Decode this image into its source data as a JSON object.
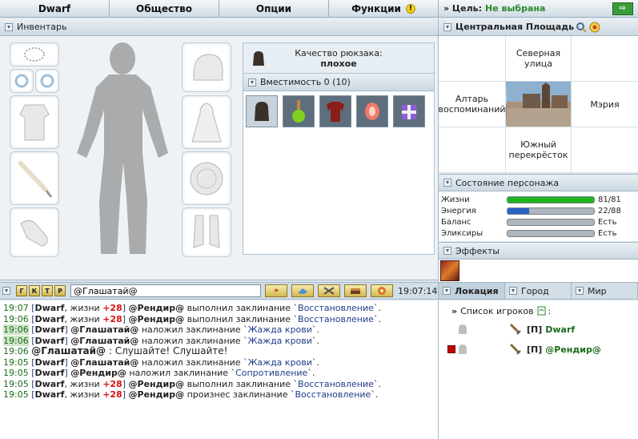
{
  "topbar": {
    "tabs": [
      "Dwarf",
      "Общество",
      "Опции",
      "Функции"
    ],
    "warn_glyph": "!"
  },
  "goal": {
    "label": "» Цель:",
    "value": "Не выбрана",
    "exit_glyph": "⇨"
  },
  "inventory": {
    "title": "Инвентарь",
    "bag_quality_label": "Качество рюкзака:",
    "bag_quality_value": "плохое",
    "capacity": "Вместимость 0 (10)"
  },
  "location": {
    "title": "Центральная Площадь",
    "north": "Северная улица",
    "west": "Алтарь воспоминаний",
    "east": "Мэрия",
    "south": "Южный перекрёсток"
  },
  "state": {
    "title": "Состояние персонажа",
    "rows": [
      {
        "label": "Жизни",
        "value": "81/81",
        "fraction": 1.0,
        "color": "#1fb51f"
      },
      {
        "label": "Энергия",
        "value": "22/88",
        "fraction": 0.25,
        "color": "#2b62c4"
      },
      {
        "label": "Баланс",
        "value": "Есть",
        "fraction": 0,
        "color": "#aeb6bd"
      },
      {
        "label": "Эликсиры",
        "value": "Есть",
        "fraction": 0,
        "color": "#aeb6bd"
      }
    ]
  },
  "effects": {
    "title": "Эффекты"
  },
  "chatbar": {
    "buttons": [
      "Г",
      "К",
      "Т",
      "Р"
    ],
    "input_value": "@Глашатай@",
    "send_glyph": "»",
    "clock": "19:07:14"
  },
  "right_tabs": [
    "Локация",
    "Город",
    "Мир"
  ],
  "players": {
    "title": "Список игроков",
    "colon": ":",
    "rows": [
      {
        "tag": "[П]",
        "name": "Dwarf"
      },
      {
        "tag": "[П]",
        "name": "@Рендир@"
      }
    ]
  },
  "chat": {
    "lines": [
      {
        "time": "19:07",
        "parts": [
          "[",
          "Dwarf",
          ", жизни ",
          "+28",
          "] ",
          "@Рендир@",
          " выполнил заклинание `",
          "Восстановление",
          "`."
        ]
      },
      {
        "time": "19:06",
        "parts": [
          "[",
          "Dwarf",
          ", жизни ",
          "+28",
          "] ",
          "@Рендир@",
          " выполнил заклинание `",
          "Восстановление",
          "`."
        ]
      },
      {
        "time": "19:06",
        "parts": [
          "[",
          "Dwarf",
          "] ",
          "@Глашатай@",
          " наложил заклинание `",
          "Жажда крови",
          "`."
        ]
      },
      {
        "time": "19:06",
        "parts": [
          "[",
          "Dwarf",
          "] ",
          "@Глашатай@",
          " наложил заклинание `",
          "Жажда крови",
          "`."
        ]
      },
      {
        "time": "19:06",
        "parts": [
          "@Глашатай@",
          " : Слушайте! Слушайте!"
        ]
      },
      {
        "time": "19:05",
        "parts": [
          "[",
          "Dwarf",
          "] ",
          "@Глашатай@",
          " наложил заклинание `",
          "Жажда крови",
          "`."
        ]
      },
      {
        "time": "19:05",
        "parts": [
          "[",
          "Dwarf",
          "] ",
          "@Рендир@",
          " наложил заклинание `",
          "Сопротивление",
          "`."
        ]
      },
      {
        "time": "19:05",
        "parts": [
          "[",
          "Dwarf",
          ", жизни ",
          "+28",
          "] ",
          "@Рендир@",
          " выполнил заклинание `",
          "Восстановление",
          "`."
        ]
      },
      {
        "time": "19:05",
        "parts": [
          "[",
          "Dwarf",
          ", жизни ",
          "+28",
          "] ",
          "@Рендир@",
          " произнес заклинание `",
          "Восстановление",
          "`."
        ]
      }
    ]
  }
}
